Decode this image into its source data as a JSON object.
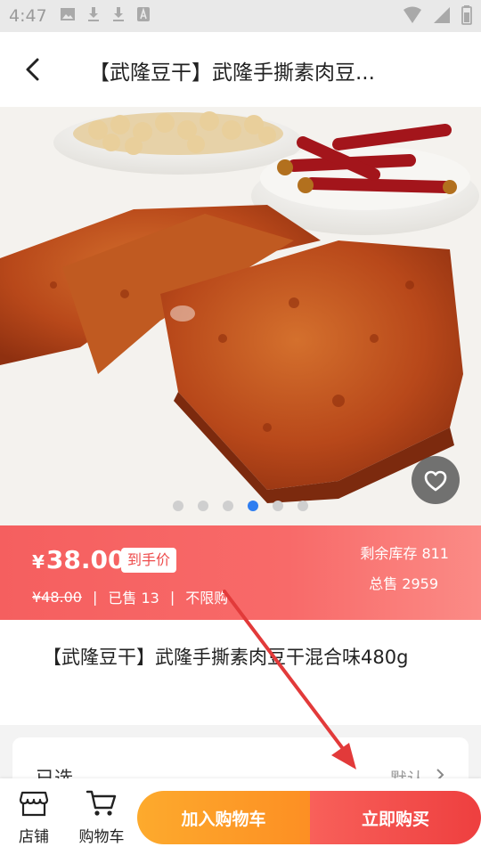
{
  "status_bar": {
    "time": "4:47"
  },
  "header": {
    "title": "【武隆豆干】武隆手撕素肉豆..."
  },
  "gallery": {
    "slide_count": 6,
    "active_index": 3
  },
  "price": {
    "currency": "¥",
    "amount": "38.00",
    "tag": "到手价",
    "old_price": "¥48.00",
    "sold": "已售 13",
    "limit": "不限购",
    "stock": "剩余库存 811",
    "total_sales": "总售 2959"
  },
  "product": {
    "name": "【武隆豆干】武隆手撕素肉豆干混合味480g"
  },
  "options": {
    "label": "已选",
    "value": "默认"
  },
  "bottom_bar": {
    "shop_label": "店铺",
    "cart_label": "购物车",
    "add_to_cart": "加入购物车",
    "buy_now": "立即购买"
  },
  "colors": {
    "price_band_start": "#f55f5f",
    "price_band_end": "#fb8b86",
    "cart_button": "#fd9a28",
    "buy_button": "#f24848",
    "active_dot": "#2f7ef0"
  }
}
